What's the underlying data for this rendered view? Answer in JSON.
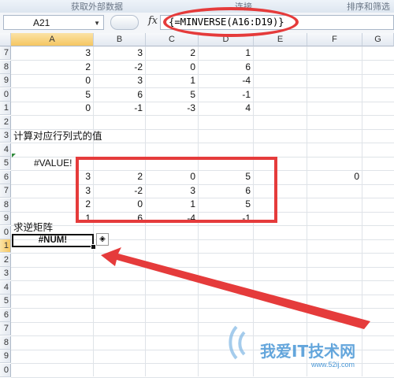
{
  "ribbon": {
    "groups": [
      "获取外部数据",
      "连接",
      "排序和筛选"
    ]
  },
  "formula_bar": {
    "name_box": "A21",
    "fx_label": "fx",
    "formula": "{=MINVERSE(A16:D19)}"
  },
  "columns": [
    "A",
    "B",
    "C",
    "D",
    "E",
    "F",
    "G"
  ],
  "rows": [
    "7",
    "8",
    "9",
    "0",
    "1",
    "2",
    "3",
    "4",
    "5",
    "6",
    "7",
    "8",
    "9",
    "0",
    "1",
    "2",
    "3",
    "4",
    "5",
    "6",
    "7",
    "8",
    "9",
    "0"
  ],
  "matrix_top": [
    [
      "3",
      "3",
      "2",
      "1"
    ],
    [
      "2",
      "-2",
      "0",
      "6"
    ],
    [
      "0",
      "3",
      "1",
      "-4"
    ],
    [
      "5",
      "6",
      "5",
      "-1"
    ],
    [
      "0",
      "-1",
      "-3",
      "4"
    ]
  ],
  "label_det": "计算对应行列式的值",
  "det_error": "#VALUE!",
  "matrix_bottom": [
    [
      "3",
      "2",
      "0",
      "5"
    ],
    [
      "3",
      "-2",
      "3",
      "6"
    ],
    [
      "2",
      "0",
      "1",
      "5"
    ],
    [
      "1",
      "6",
      "-4",
      "-1"
    ]
  ],
  "f16_value": "0",
  "label_inverse": "求逆矩阵",
  "active_cell_value": "#NUM!",
  "error_button_icon": "warning-diamond-icon",
  "watermark": {
    "main": "我爱IT技术网",
    "sub": "www.52ij.com"
  },
  "colors": {
    "annotation": "#e53b3b",
    "header_selected": "#f5c662"
  }
}
